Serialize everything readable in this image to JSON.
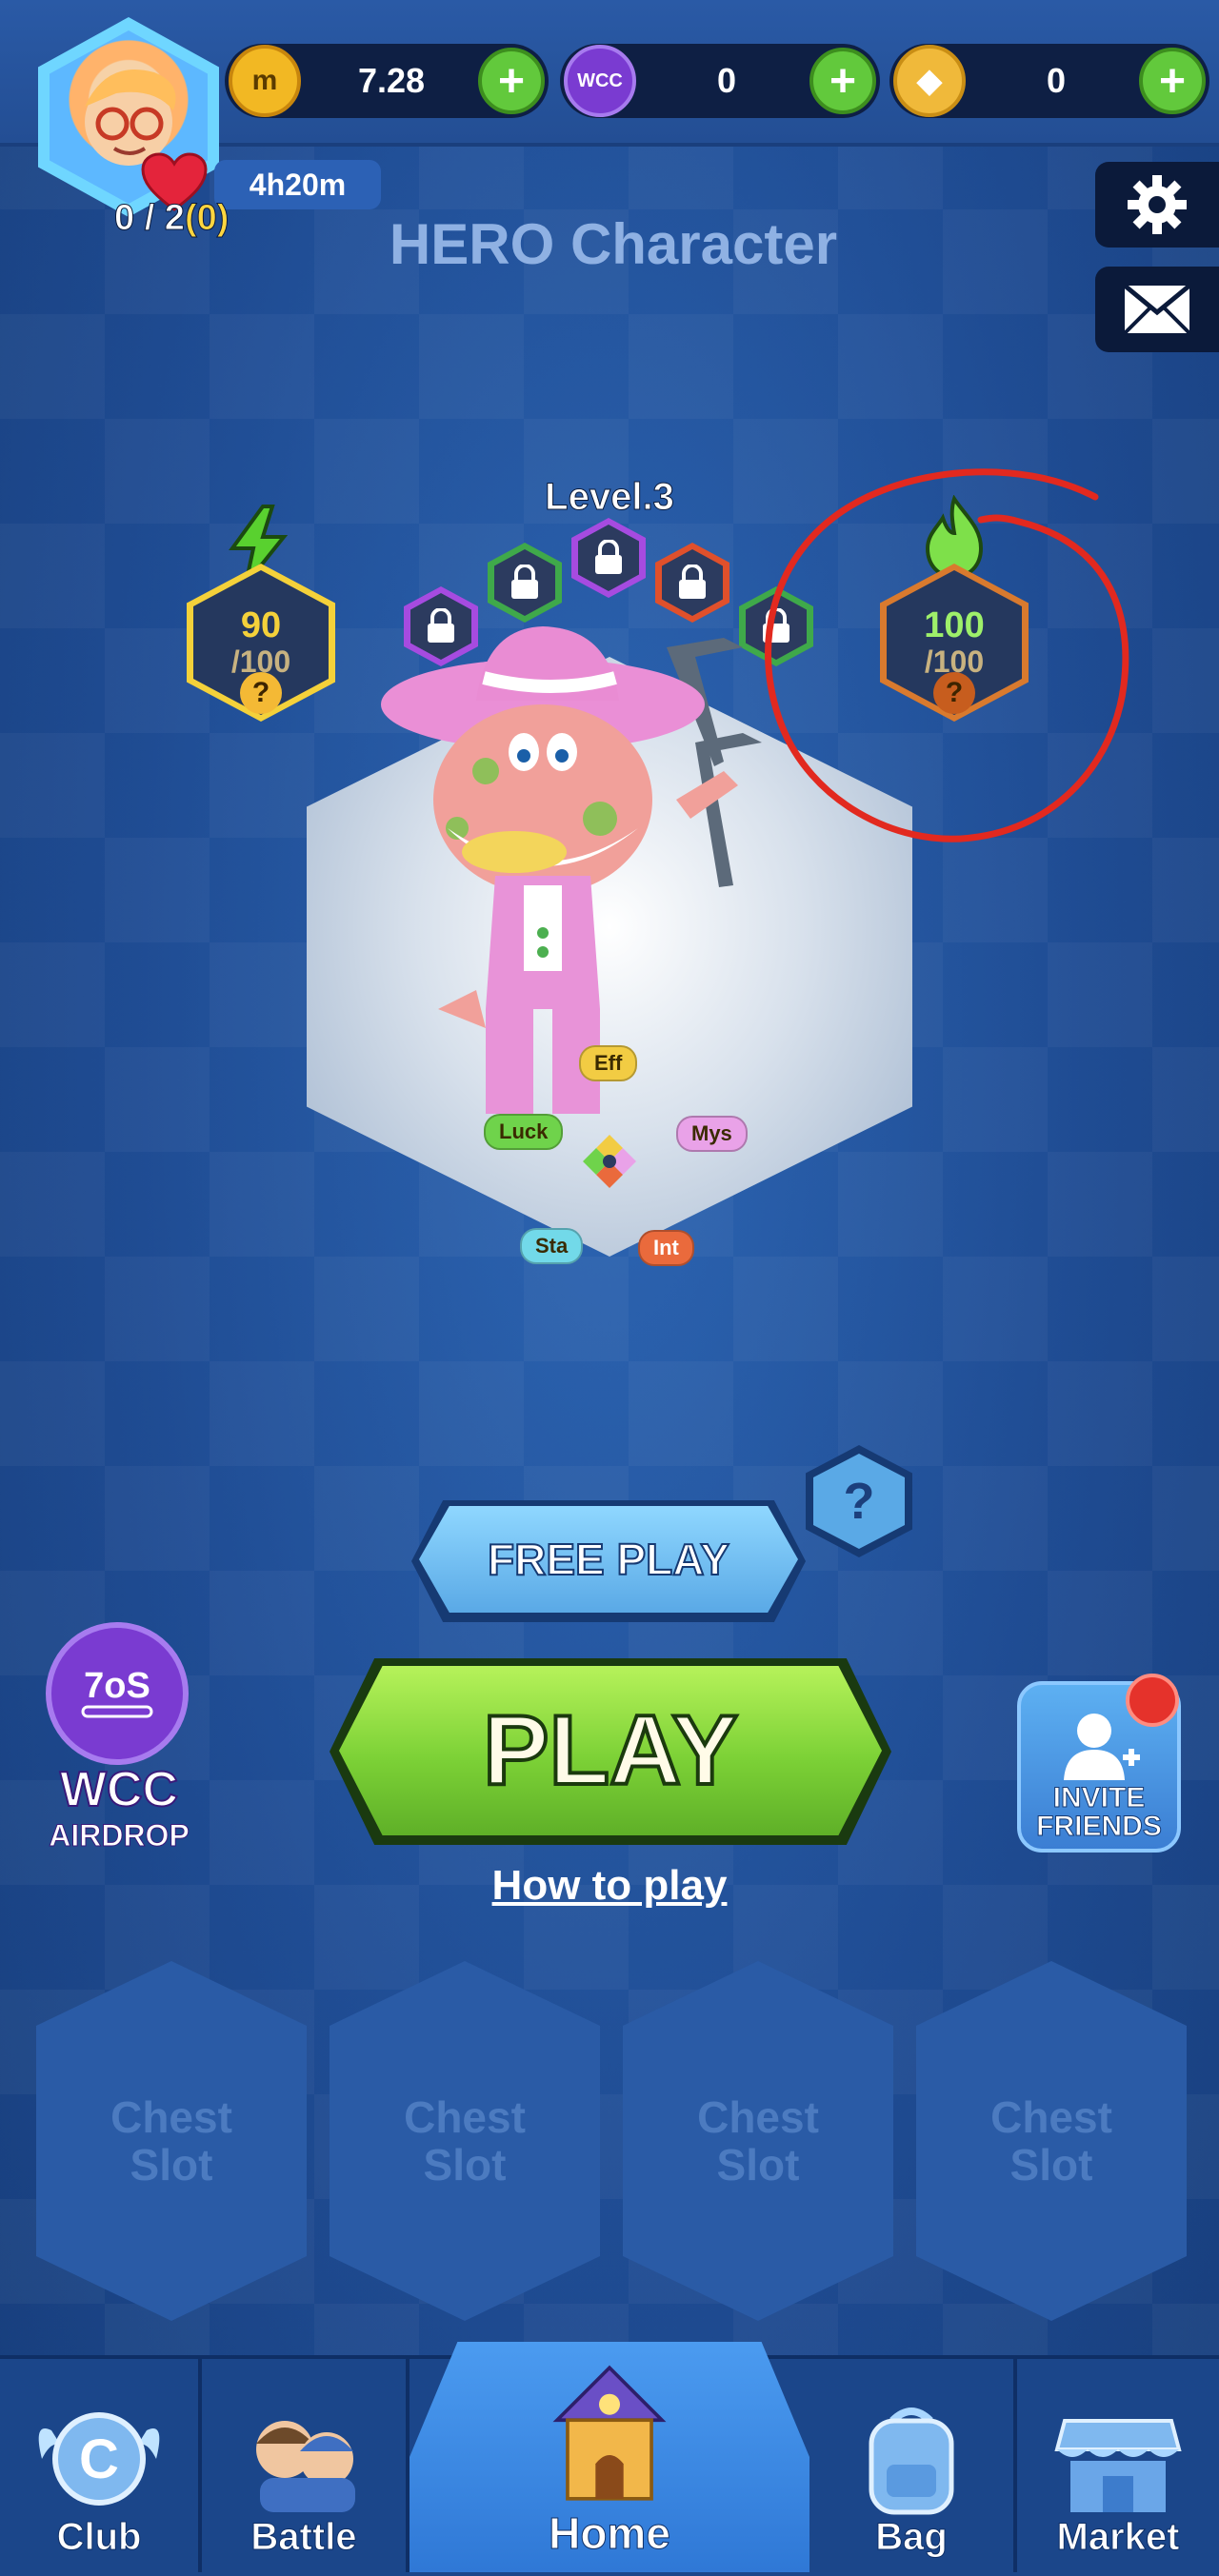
{
  "header": {
    "currencies": [
      {
        "name": "coin-m",
        "value": "7.28",
        "icon_text": "m",
        "color": "#f2b823"
      },
      {
        "name": "wcc-token",
        "value": "0",
        "icon_text": "WCC",
        "color": "#7a3bd1"
      },
      {
        "name": "bnb-token",
        "value": "0",
        "icon_text": "◆",
        "color": "#f0b93a"
      }
    ],
    "timer": "4h20m",
    "energy": {
      "current": "0 / 2",
      "bonus": "(0)"
    }
  },
  "page": {
    "title": "HERO Character"
  },
  "character": {
    "level": "Level.3",
    "left_stat": {
      "current": "90",
      "max": "/100",
      "color": "#f4d13a"
    },
    "right_stat": {
      "current": "100",
      "max": "/100",
      "color": "#7ee04a"
    },
    "traits": [
      "Eff",
      "Luck",
      "Mys",
      "Sta",
      "Int"
    ],
    "lock_colors": [
      "#a64be0",
      "#3fa94a",
      "#a64be0",
      "#e0502b",
      "#3fa94a"
    ]
  },
  "actions": {
    "free_play": "FREE PLAY",
    "help": "?",
    "play": "PLAY",
    "how_to_play": "How to play"
  },
  "side": {
    "wcc_title": "WCC",
    "wcc_sub": "AIRDROP",
    "invite_line1": "INVITE",
    "invite_line2": "FRIENDS"
  },
  "chests": [
    {
      "line1": "Chest",
      "line2": "Slot"
    },
    {
      "line1": "Chest",
      "line2": "Slot"
    },
    {
      "line1": "Chest",
      "line2": "Slot"
    },
    {
      "line1": "Chest",
      "line2": "Slot"
    }
  ],
  "nav": [
    {
      "label": "Club"
    },
    {
      "label": "Battle"
    },
    {
      "label": "Home",
      "active": true
    },
    {
      "label": "Bag"
    },
    {
      "label": "Market"
    }
  ]
}
